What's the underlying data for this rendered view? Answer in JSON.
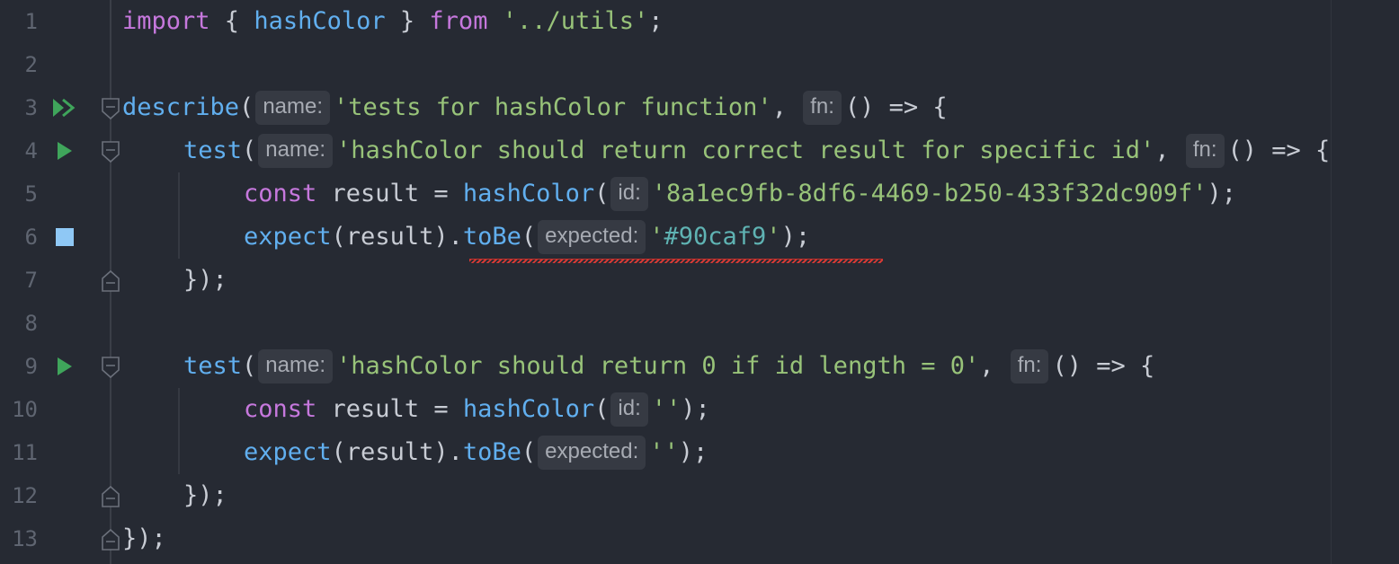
{
  "editor": {
    "colors": {
      "background": "#262a33",
      "keyword": "#c678dd",
      "function": "#61afef",
      "string": "#98c379",
      "line_number": "#5f6571",
      "run_icon": "#3fa55b",
      "stop_icon": "#8fc8f5",
      "error_underline": "#d63a35"
    },
    "lines": [
      {
        "num": "1",
        "parts": [
          {
            "t": "import",
            "c": "kw"
          },
          {
            "t": " { ",
            "c": "pn"
          },
          {
            "t": "hashColor",
            "c": "fn"
          },
          {
            "t": " } ",
            "c": "pn"
          },
          {
            "t": "from",
            "c": "kw"
          },
          {
            "t": " '../utils'",
            "c": "str"
          },
          {
            "t": ";",
            "c": "pn"
          }
        ]
      },
      {
        "num": "2",
        "parts": []
      },
      {
        "num": "3",
        "gutter": "run-all-icon",
        "fold": "fold-open-icon",
        "parts": [
          {
            "t": "describe",
            "c": "fn"
          },
          {
            "t": "(",
            "c": "pn"
          },
          {
            "t": "name:",
            "c": "hint"
          },
          {
            "t": "'tests for hashColor function'",
            "c": "str"
          },
          {
            "t": ", ",
            "c": "pn"
          },
          {
            "t": "fn:",
            "c": "hint"
          },
          {
            "t": "() => {",
            "c": "pn"
          }
        ]
      },
      {
        "num": "4",
        "gutter": "run-icon",
        "fold": "fold-open-icon",
        "parts": [
          {
            "t": "test",
            "c": "fn"
          },
          {
            "t": "(",
            "c": "pn"
          },
          {
            "t": "name:",
            "c": "hint"
          },
          {
            "t": "'hashColor should return correct result for specific id'",
            "c": "str"
          },
          {
            "t": ", ",
            "c": "pn"
          },
          {
            "t": "fn:",
            "c": "hint"
          },
          {
            "t": "() => {",
            "c": "pn"
          }
        ]
      },
      {
        "num": "5",
        "parts": [
          {
            "t": "const",
            "c": "kw"
          },
          {
            "t": " result = ",
            "c": "pn"
          },
          {
            "t": "hashColor",
            "c": "fn"
          },
          {
            "t": "(",
            "c": "pn"
          },
          {
            "t": "id:",
            "c": "hint"
          },
          {
            "t": "'8a1ec9fb-8df6-4469-b250-433f32dc909f'",
            "c": "str"
          },
          {
            "t": ");",
            "c": "pn"
          }
        ]
      },
      {
        "num": "6",
        "gutter": "color-swatch-icon",
        "parts": [
          {
            "t": "expect",
            "c": "fn"
          },
          {
            "t": "(result).",
            "c": "pn"
          },
          {
            "t": "toBe",
            "c": "fn"
          },
          {
            "t": "(",
            "c": "pn"
          },
          {
            "t": "expected:",
            "c": "hint"
          },
          {
            "t": "'",
            "c": "str"
          },
          {
            "t": "#90caf9",
            "c": "col"
          },
          {
            "t": "'",
            "c": "str"
          },
          {
            "t": ");",
            "c": "pn"
          }
        ]
      },
      {
        "num": "7",
        "fold": "fold-close-icon",
        "parts": [
          {
            "t": "});",
            "c": "pn"
          }
        ]
      },
      {
        "num": "8",
        "parts": []
      },
      {
        "num": "9",
        "gutter": "run-icon",
        "fold": "fold-open-icon",
        "parts": [
          {
            "t": "test",
            "c": "fn"
          },
          {
            "t": "(",
            "c": "pn"
          },
          {
            "t": "name:",
            "c": "hint"
          },
          {
            "t": "'hashColor should return 0 if id length = 0'",
            "c": "str"
          },
          {
            "t": ", ",
            "c": "pn"
          },
          {
            "t": "fn:",
            "c": "hint"
          },
          {
            "t": "() => {",
            "c": "pn"
          }
        ]
      },
      {
        "num": "10",
        "parts": [
          {
            "t": "const",
            "c": "kw"
          },
          {
            "t": " result = ",
            "c": "pn"
          },
          {
            "t": "hashColor",
            "c": "fn"
          },
          {
            "t": "(",
            "c": "pn"
          },
          {
            "t": "id:",
            "c": "hint"
          },
          {
            "t": "''",
            "c": "str"
          },
          {
            "t": ");",
            "c": "pn"
          }
        ]
      },
      {
        "num": "11",
        "parts": [
          {
            "t": "expect",
            "c": "fn"
          },
          {
            "t": "(result).",
            "c": "pn"
          },
          {
            "t": "toBe",
            "c": "fn"
          },
          {
            "t": "(",
            "c": "pn"
          },
          {
            "t": "expected:",
            "c": "hint"
          },
          {
            "t": "''",
            "c": "str"
          },
          {
            "t": ");",
            "c": "pn"
          }
        ]
      },
      {
        "num": "12",
        "fold": "fold-close-icon",
        "parts": [
          {
            "t": "});",
            "c": "pn"
          }
        ]
      },
      {
        "num": "13",
        "fold": "fold-close-icon",
        "parts": [
          {
            "t": "});",
            "c": "pn"
          }
        ]
      }
    ]
  }
}
